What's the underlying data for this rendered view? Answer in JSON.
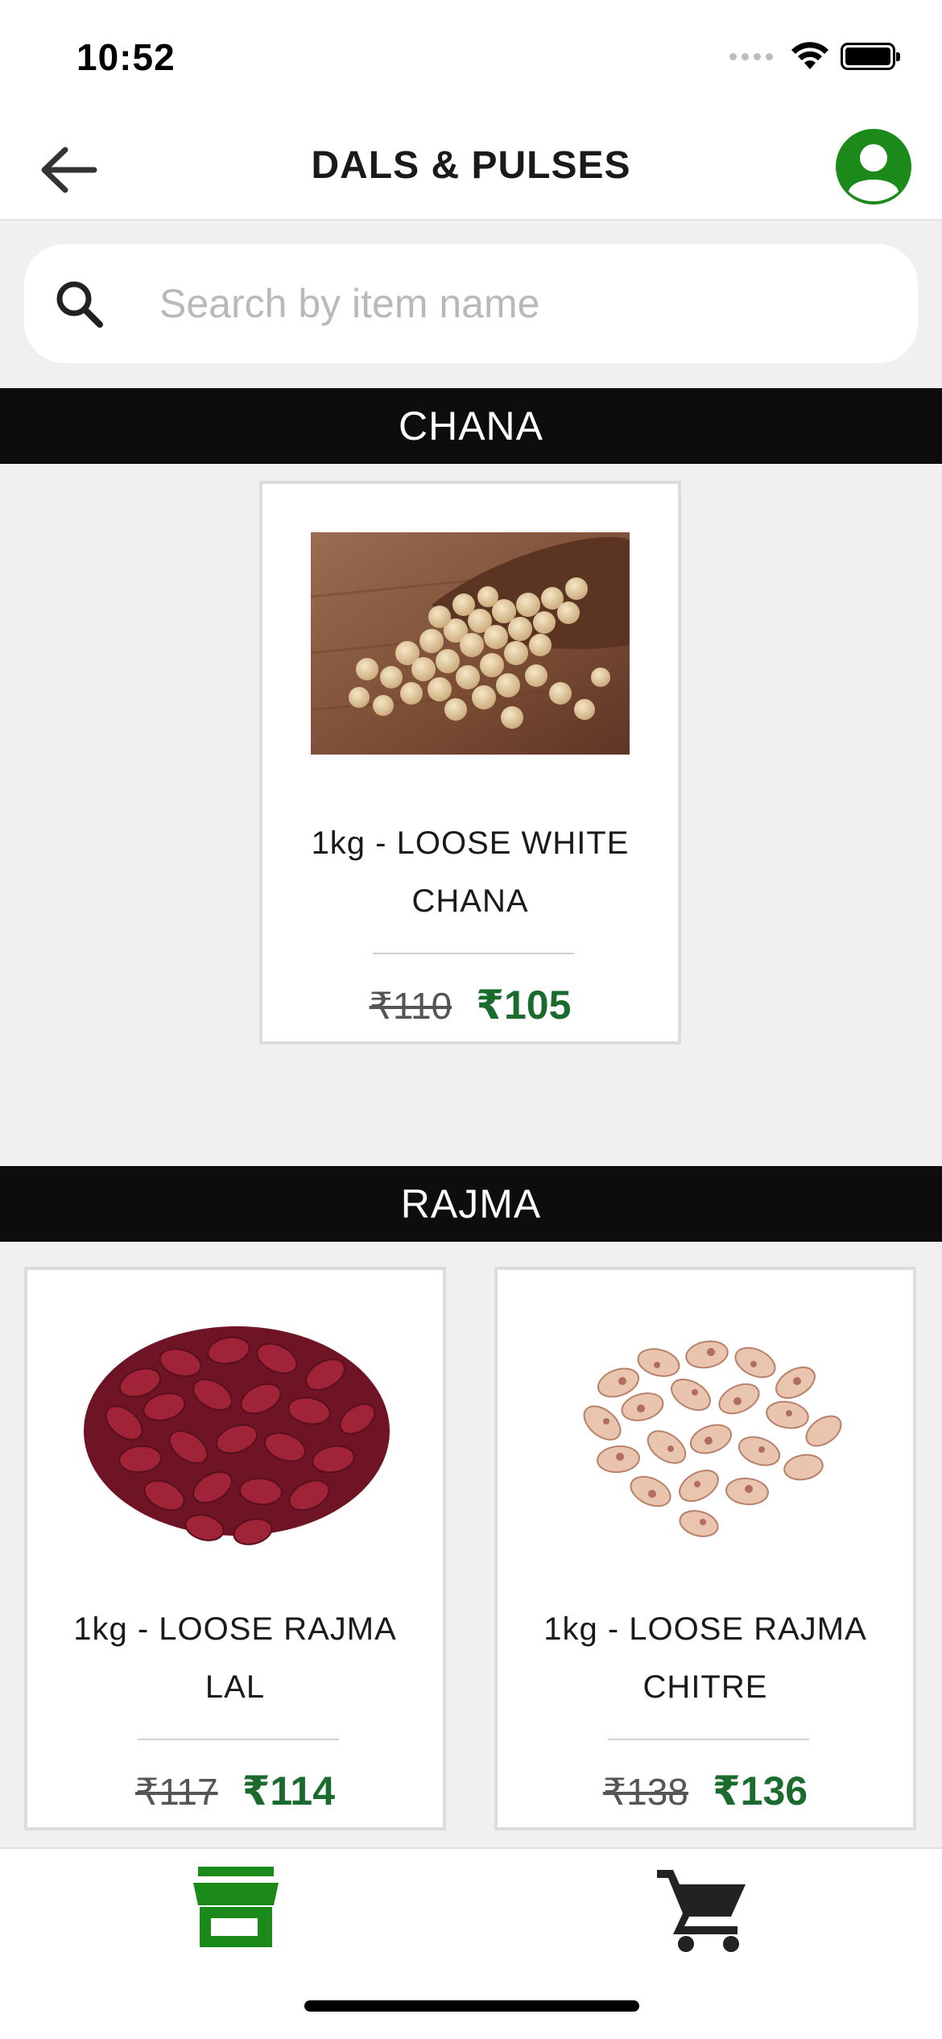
{
  "status_bar": {
    "time": "10:52"
  },
  "header": {
    "title": "DALS & PULSES"
  },
  "search": {
    "placeholder": "Search by item name",
    "value": ""
  },
  "categories": [
    {
      "name": "CHANA",
      "products": [
        {
          "name": "1kg - LOOSE WHITE CHANA",
          "old_price": "₹110",
          "new_price": "₹105"
        }
      ]
    },
    {
      "name": "RAJMA",
      "products": [
        {
          "name": "1kg - LOOSE RAJMA LAL",
          "old_price": "₹117",
          "new_price": "₹114"
        },
        {
          "name": "1kg - LOOSE RAJMA CHITRE",
          "old_price": "₹138",
          "new_price": "₹136"
        }
      ]
    }
  ],
  "bottom_nav": {
    "active": "store"
  },
  "colors": {
    "accent": "#1b8a1b",
    "price_green": "#1b6b2f",
    "category_bar": "#0d0d0d",
    "background": "#f0f0f0"
  }
}
